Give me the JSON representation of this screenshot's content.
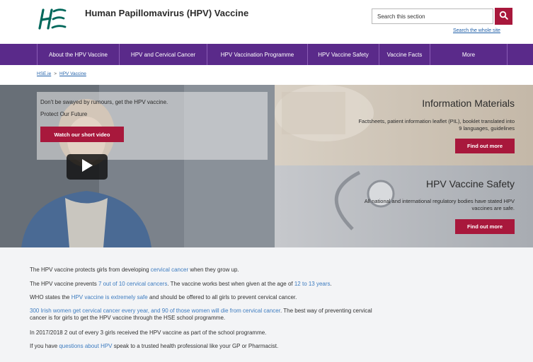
{
  "header": {
    "title": "Human Papillomavirus (HPV) Vaccine",
    "search_value": "Search this section",
    "search_whole": "Search the whole site",
    "brand_color": "#a8183c"
  },
  "nav": {
    "color": "#5a2a8a",
    "items": [
      {
        "label": "About the HPV Vaccine"
      },
      {
        "label": "HPV and Cervical Cancer"
      },
      {
        "label": "HPV Vaccination Programme"
      },
      {
        "label": "HPV Vaccine Safety"
      },
      {
        "label": "Vaccine Facts"
      },
      {
        "label": "More"
      }
    ]
  },
  "breadcrumb": {
    "home": "HSE.ie",
    "separator": ">",
    "current": "HPV Vaccine"
  },
  "hero": {
    "line1": "Don't be swayed by rumours, get the HPV vaccine.",
    "line2": "Protect Our Future",
    "video_button": "Watch our short video"
  },
  "panels": {
    "info": {
      "title": "Information Materials",
      "desc_line1": "Factsheets, patient information leaflet (PIL), booklet translated into",
      "desc_line2": "9 languages, guidelines",
      "button": "Find out more"
    },
    "safety": {
      "title": "HPV Vaccine Safety",
      "desc_line1": "All national and international regulatory bodies have stated HPV",
      "desc_line2": "vaccines are safe.",
      "button": "Find out more"
    }
  },
  "content": {
    "p1": {
      "a": "The HPV vaccine protects girls from developing ",
      "link": "cervical cancer",
      "b": " when they grow up."
    },
    "p2": {
      "a": "The HPV vaccine prevents ",
      "link1": "7 out of 10 cervical cancers",
      "b": ". The vaccine works best when given at the age of ",
      "link2": "12 to 13 years",
      "c": "."
    },
    "p3": {
      "a": "WHO states the ",
      "link": "HPV vaccine is extremely safe",
      "b": " and should be offered to all girls to prevent cervical cancer."
    },
    "p4": {
      "link": "300 Irish women get cervical cancer every year, and 90 of those women will die from cervical cancer",
      "a": ". The best way of preventing cervical",
      "line2": "cancer is for girls to get the HPV vaccine through the HSE school programme."
    },
    "p5": {
      "text": "In 2017/2018 2 out of every 3 girls received the HPV vaccine as part of the school programme."
    },
    "p6": {
      "a": "If you have ",
      "link": "questions about HPV",
      "b": " speak to a trusted health professional like your GP or Pharmacist."
    }
  }
}
